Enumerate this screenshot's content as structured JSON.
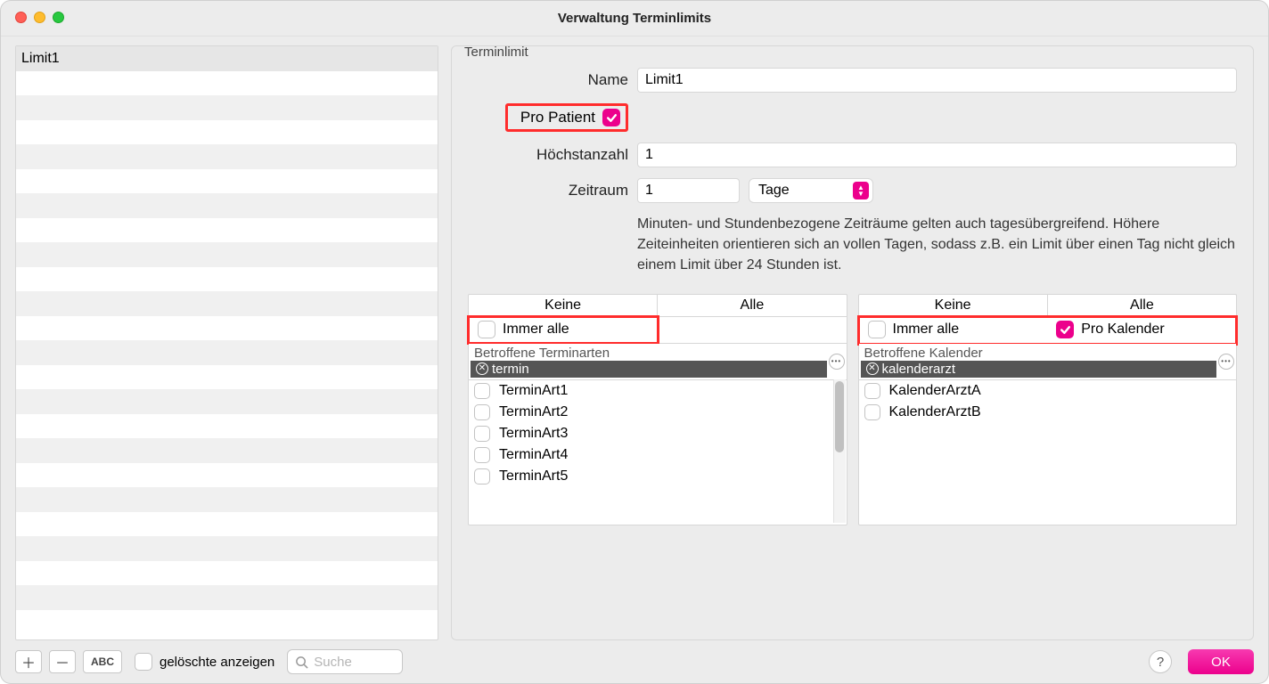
{
  "window": {
    "title": "Verwaltung Terminlimits"
  },
  "sidebar": {
    "items": [
      "Limit1"
    ]
  },
  "group": {
    "title": "Terminlimit",
    "labels": {
      "name": "Name",
      "proPatient": "Pro Patient",
      "hoechstanzahl": "Höchstanzahl",
      "zeitraum": "Zeitraum"
    },
    "fields": {
      "name": "Limit1",
      "proPatientChecked": true,
      "hoechstanzahl": "1",
      "zeitraumValue": "1",
      "zeitraumUnit": "Tage"
    },
    "info": "Minuten- und Stundenbezogene Zeiträume gelten auch tagesübergreifend. Höhere Zeiteinheiten orientieren sich an vollen Tagen, sodass z.B. ein Limit über einen Tag nicht gleich einem Limit über 24 Stunden ist."
  },
  "panels": {
    "left": {
      "headers": [
        "Keine",
        "Alle"
      ],
      "immerAlleLabel": "Immer alle",
      "immerAlleChecked": false,
      "filterLabel": "Betroffene Terminarten",
      "filterValue": "termin",
      "items": [
        "TerminArt1",
        "TerminArt2",
        "TerminArt3",
        "TerminArt4",
        "TerminArt5"
      ]
    },
    "right": {
      "headers": [
        "Keine",
        "Alle"
      ],
      "immerAlleLabel": "Immer alle",
      "immerAlleChecked": false,
      "proKalenderLabel": "Pro Kalender",
      "proKalenderChecked": true,
      "filterLabel": "Betroffene Kalender",
      "filterValue": "kalenderarzt",
      "items": [
        "KalenderArztA",
        "KalenderArztB"
      ]
    }
  },
  "bottom": {
    "abc": "ABC",
    "deletedLabel": "gelöschte anzeigen",
    "searchPlaceholder": "Suche",
    "ok": "OK"
  }
}
